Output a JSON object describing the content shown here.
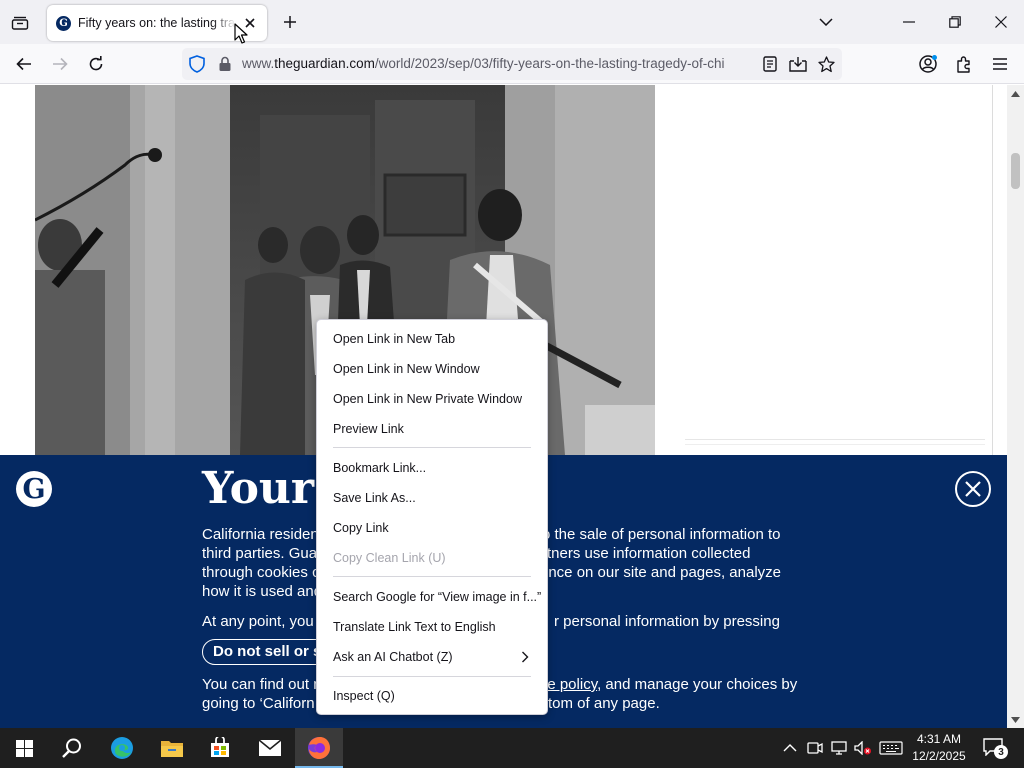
{
  "browser": {
    "tab": {
      "title": "Fifty years on: the lasting tragedy of Chile",
      "favicon_letter": "G"
    },
    "address": {
      "url_prefix": "www.",
      "url_host": "theguardian.com",
      "url_path": "/world/2023/sep/03/fifty-years-on-the-lasting-tragedy-of-chi"
    }
  },
  "consent_banner": {
    "logo_letter": "G",
    "title_start": "Your p",
    "para1_lines": [
      "California residen",
      "third parties. Gua",
      "through cookies c",
      "how it is used and"
    ],
    "para1_right_lines": [
      "o the sale of personal information to",
      "tners use information collected",
      "ence on our site and pages, analyze",
      ""
    ],
    "para2_left": "At any point, you",
    "para2_right": "r personal information by pressing",
    "dns_button_label": "Do not sell or s",
    "para3_line1_left": "You can find out m",
    "para3_line1_link": "ie policy",
    "para3_line1_right": ", and manage your choices by",
    "para3_line2_left": "going to ‘Californ",
    "para3_line2_right": "tom of any page."
  },
  "context_menu": {
    "items": [
      {
        "label": "Open Link in New Tab",
        "disabled": false
      },
      {
        "label": "Open Link in New Window",
        "disabled": false
      },
      {
        "label": "Open Link in New Private Window",
        "disabled": false
      },
      {
        "label": "Preview Link",
        "disabled": false
      },
      {
        "label": "Bookmark Link...",
        "disabled": false
      },
      {
        "label": "Save Link As...",
        "disabled": false
      },
      {
        "label": "Copy Link",
        "disabled": false
      },
      {
        "label": "Copy Clean Link (U)",
        "disabled": true
      },
      {
        "label": "Search Google for “View image in f...”",
        "disabled": false
      },
      {
        "label": "Translate Link Text to English",
        "disabled": false
      },
      {
        "label": "Ask an AI Chatbot (Z)",
        "disabled": false
      },
      {
        "label": "Inspect (Q)",
        "disabled": false
      }
    ]
  },
  "taskbar": {
    "time": "4:31 AM",
    "date": "12/2/2025",
    "notification_count": "3"
  },
  "colors": {
    "guardian_blue": "#052962",
    "taskbar": "#1f1f1f",
    "accent": "#0060df"
  },
  "icons": [
    "tab-list-icon",
    "close-icon",
    "plus-icon",
    "chevron-down-icon",
    "minimize-icon",
    "maximize-icon",
    "back-icon",
    "forward-icon",
    "reload-icon",
    "shield-icon",
    "lock-icon",
    "reader-view-icon",
    "download-icon",
    "star-icon",
    "account-icon",
    "extensions-icon",
    "menu-icon",
    "windows-start-icon",
    "search-icon",
    "edge-icon",
    "file-explorer-icon",
    "store-icon",
    "mail-icon",
    "firefox-icon",
    "chevron-up-icon",
    "volume-muted-icon",
    "keyboard-icon",
    "notifications-icon"
  ]
}
